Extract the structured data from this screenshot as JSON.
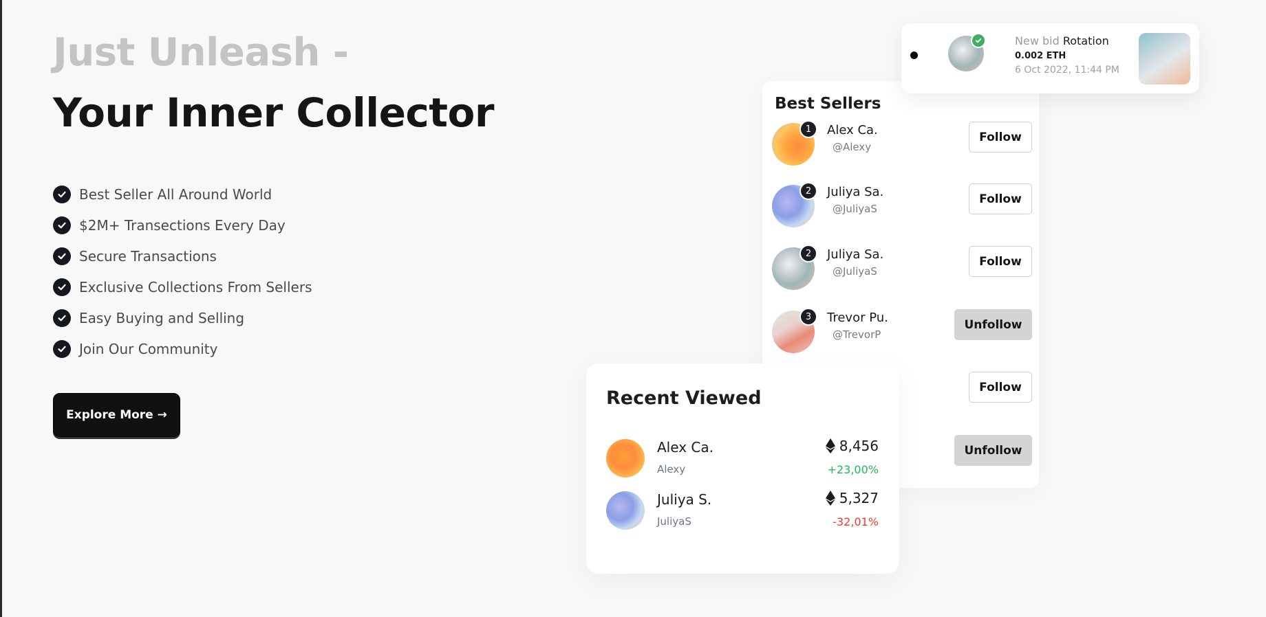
{
  "hero": {
    "subtitle": "Just Unleash -",
    "title": "Your Inner Collector"
  },
  "features": [
    {
      "label": "Best Seller All Around World"
    },
    {
      "label": "$2M+ Transections Every Day"
    },
    {
      "label": "Secure Transactions"
    },
    {
      "label": "Exclusive Collections From Sellers"
    },
    {
      "label": "Easy Buying and Selling"
    },
    {
      "label": "Join Our Community"
    }
  ],
  "cta": {
    "label": "Explore More →"
  },
  "notification": {
    "prefix": "New bid",
    "item": "Rotation",
    "amount": "0.002 ETH",
    "date": "6 Oct 2022, 11:44 PM"
  },
  "best_sellers": {
    "title": "Best Sellers",
    "sellers": [
      {
        "rank": "1",
        "name": "Alex Ca.",
        "handle": "@Alexy",
        "action": "Follow"
      },
      {
        "rank": "2",
        "name": "Juliya Sa.",
        "handle": "@JuliyaS",
        "action": "Follow"
      },
      {
        "rank": "2",
        "name": "Juliya Sa.",
        "handle": "@JuliyaS",
        "action": "Follow"
      },
      {
        "rank": "3",
        "name": "Trevor Pu.",
        "handle": "@TrevorP",
        "action": "Unfollow"
      },
      {
        "action": "Follow"
      },
      {
        "action": "Unfollow"
      }
    ]
  },
  "recent_viewed": {
    "title": "Recent Viewed",
    "items": [
      {
        "name": "Alex Ca.",
        "handle": "Alexy",
        "price": "8,456",
        "change": "+23,00%"
      },
      {
        "name": "Juliya S.",
        "handle": "JuliyaS",
        "price": "5,327",
        "change": "-32,01%"
      }
    ]
  }
}
